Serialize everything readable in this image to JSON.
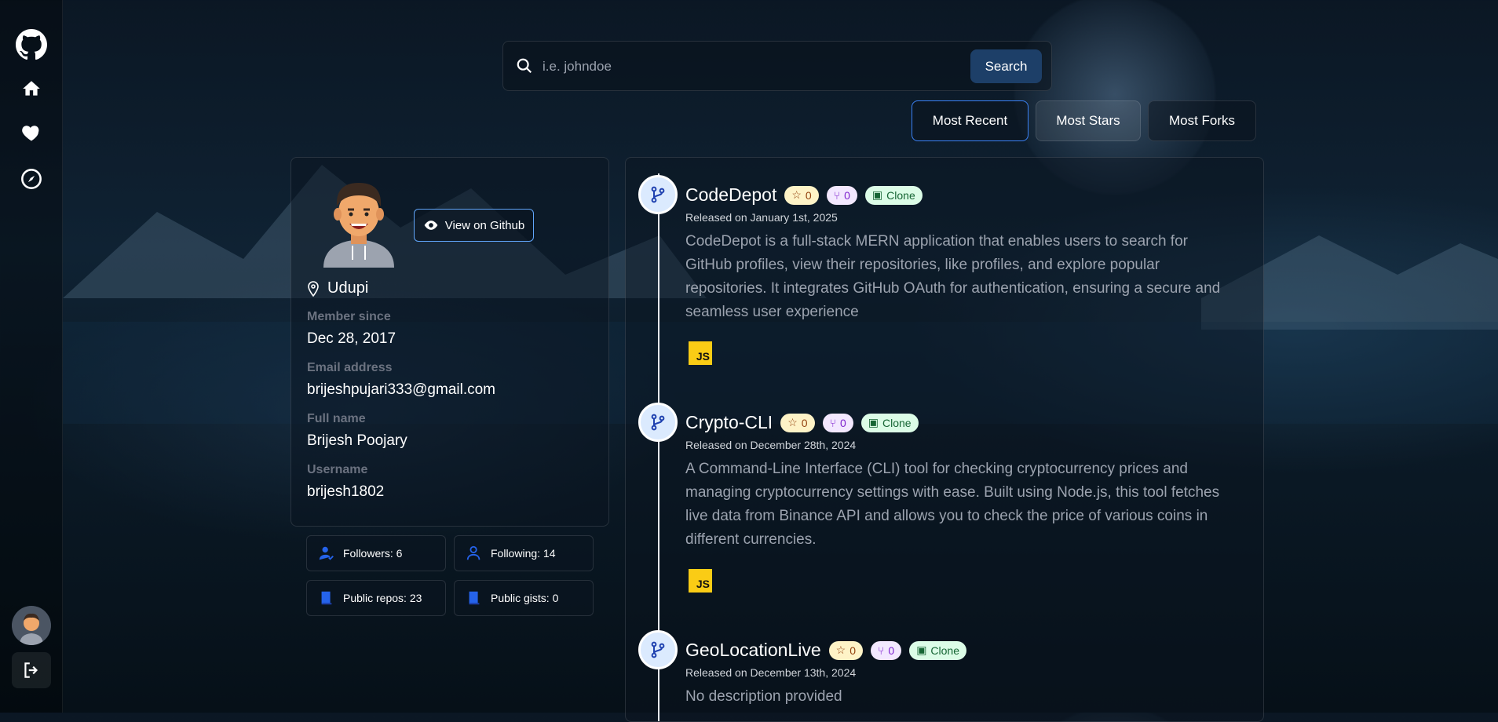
{
  "search": {
    "placeholder": "i.e. johndoe",
    "button": "Search"
  },
  "sort": {
    "recent": "Most Recent",
    "stars": "Most Stars",
    "forks": "Most Forks"
  },
  "profile": {
    "view_github": "View on Github",
    "location": "Udupi",
    "fields": [
      {
        "label": "Member since",
        "value": "Dec 28, 2017"
      },
      {
        "label": "Email address",
        "value": "brijeshpujari333@gmail.com"
      },
      {
        "label": "Full name",
        "value": "Brijesh Poojary"
      },
      {
        "label": "Username",
        "value": "brijesh1802"
      }
    ]
  },
  "stats": {
    "followers": "Followers: 6",
    "following": "Following: 14",
    "public_repos": "Public repos: 23",
    "public_gists": "Public gists: 0"
  },
  "repos": [
    {
      "name": "CodeDepot",
      "stars": "0",
      "forks": "0",
      "clone": "Clone",
      "date": "Released on January 1st, 2025",
      "description": "CodeDepot is a full-stack MERN application that enables users to search for GitHub profiles, view their repositories, like profiles, and explore popular repositories. It integrates GitHub OAuth for authentication, ensuring a secure and seamless user experience",
      "language": "JS"
    },
    {
      "name": "Crypto-CLI",
      "stars": "0",
      "forks": "0",
      "clone": "Clone",
      "date": "Released on December 28th, 2024",
      "description": "A Command-Line Interface (CLI) tool for checking cryptocurrency prices and managing cryptocurrency settings with ease. Built using Node.js, this tool fetches live data from Binance API and allows you to check the price of various coins in different currencies.",
      "language": "JS"
    },
    {
      "name": "GeoLocationLive",
      "stars": "0",
      "forks": "0",
      "clone": "Clone",
      "date": "Released on December 13th, 2024",
      "description": "No description provided"
    }
  ]
}
